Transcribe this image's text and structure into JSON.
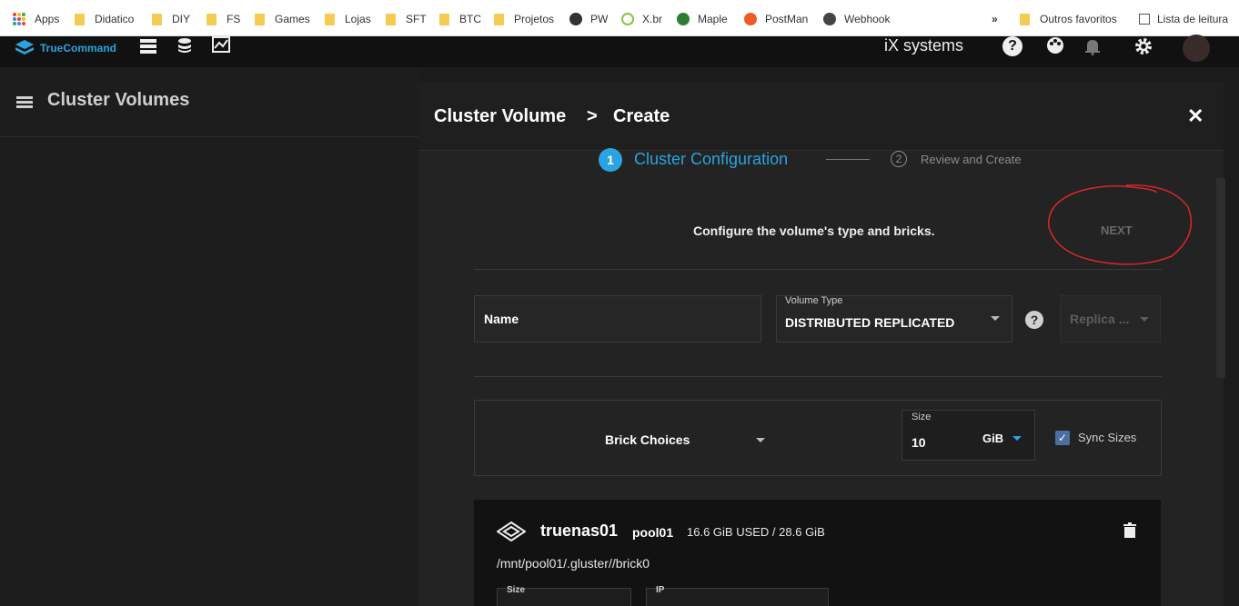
{
  "bookmarks": {
    "items": [
      "Apps",
      "Didatico",
      "DIY",
      "FS",
      "Games",
      "Lojas",
      "SFT",
      "BTC",
      "Projetos",
      "PW",
      "X.br",
      "Maple",
      "PostMan",
      "Webhook"
    ],
    "overflow": "»",
    "other_folder": "Outros favoritos",
    "reading_list": "Lista de leitura"
  },
  "app": {
    "logo": "TrueCommand",
    "brand": "iX systems",
    "accent": "#2aa3e0"
  },
  "sidebar": {
    "title": "Cluster Volumes"
  },
  "dialog": {
    "breadcrumb_parent": "Cluster Volume",
    "breadcrumb_sep": ">",
    "breadcrumb_current": "Create",
    "close": "✕",
    "stepper": {
      "step1_number": "1",
      "step1_label": "Cluster Configuration",
      "step2_number": "2",
      "step2_label": "Review and Create"
    },
    "instruction": "Configure the volume's type and bricks.",
    "next": "NEXT",
    "form": {
      "name_label": "Name",
      "volume_type_label": "Volume Type",
      "volume_type_value": "DISTRIBUTED REPLICATED",
      "help": "?",
      "replica_label": "Replica ...",
      "brick_choices": "Brick Choices",
      "size_label": "Size",
      "size_value": "10",
      "size_unit": "GiB",
      "sync_sizes": "Sync Sizes"
    },
    "brick": {
      "host": "truenas01",
      "pool": "pool01",
      "usage": "16.6 GiB USED / 28.6 GiB",
      "path": "/mnt/pool01/.gluster//brick0",
      "size_label": "Size",
      "ip_label": "IP"
    }
  }
}
